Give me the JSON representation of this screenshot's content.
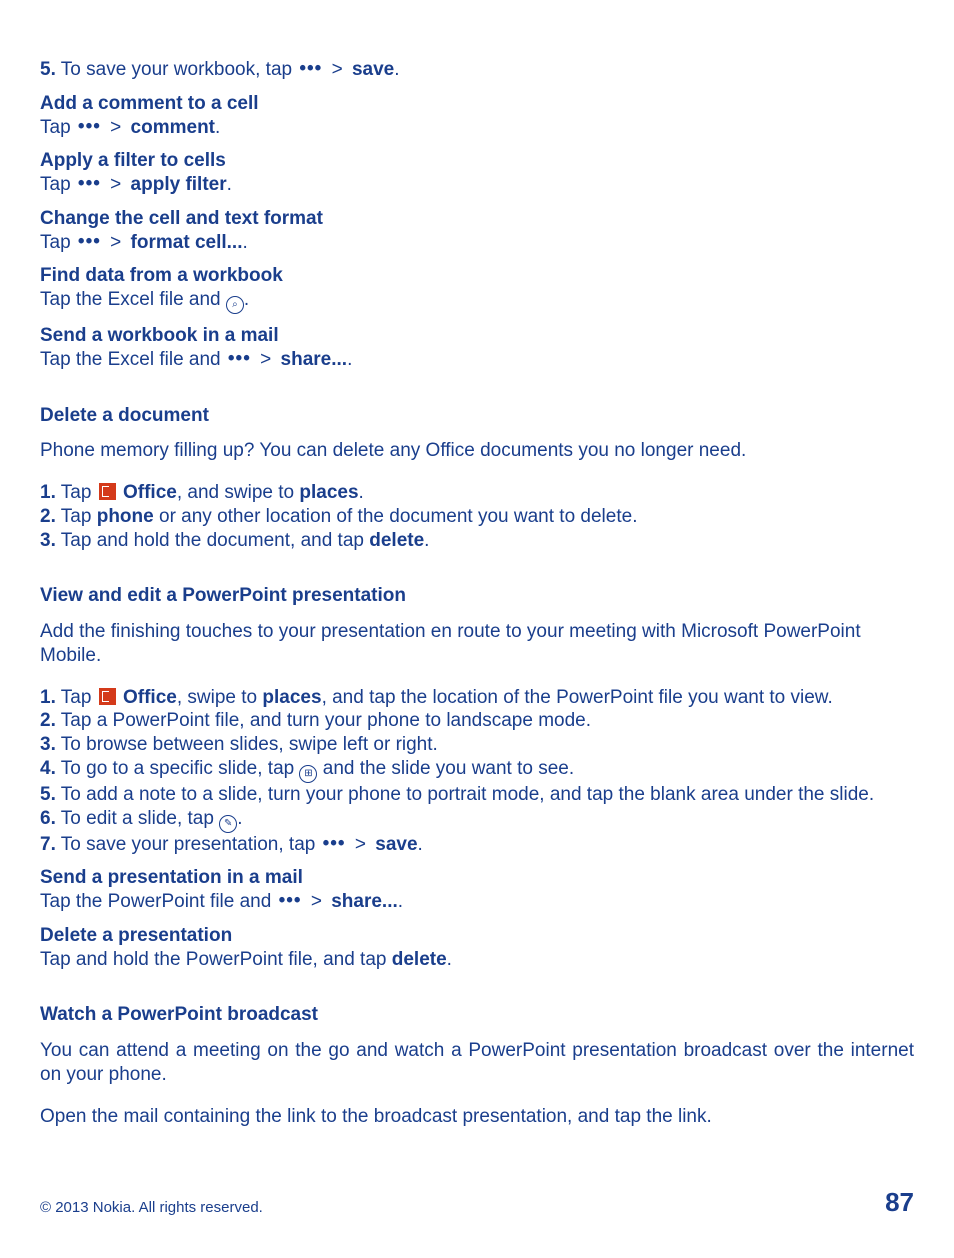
{
  "save_workbook": {
    "num": "5.",
    "pre": " To save your workbook, tap ",
    "after_dots": " > ",
    "bold": "save",
    "tail": "."
  },
  "add_comment": {
    "heading": "Add a comment to a cell",
    "pre": "Tap ",
    "after_dots": " > ",
    "bold": "comment",
    "tail": "."
  },
  "apply_filter": {
    "heading": "Apply a filter to cells",
    "pre": "Tap ",
    "after_dots": " > ",
    "bold": "apply filter",
    "tail": "."
  },
  "format_cell": {
    "heading": "Change the cell and text format",
    "pre": "Tap ",
    "after_dots": " > ",
    "bold": "format cell...",
    "tail": "."
  },
  "find_data": {
    "heading": "Find data from a workbook",
    "pre": "Tap the Excel file and ",
    "tail": "."
  },
  "send_workbook": {
    "heading": "Send a workbook in a mail",
    "pre": "Tap the Excel file and ",
    "after_dots": " > ",
    "bold": "share...",
    "tail": "."
  },
  "delete_doc": {
    "heading": "Delete a document",
    "intro": "Phone memory filling up? You can delete any Office documents you no longer need.",
    "s1": {
      "num": "1.",
      "pre": " Tap ",
      "bold1": "Office",
      "mid": ", and swipe to ",
      "bold2": "places",
      "tail": "."
    },
    "s2": {
      "num": "2.",
      "pre": " Tap ",
      "bold": "phone",
      "tail": " or any other location of the document you want to delete."
    },
    "s3": {
      "num": "3.",
      "pre": " Tap and hold the document, and tap ",
      "bold": "delete",
      "tail": "."
    }
  },
  "ppt": {
    "heading": "View and edit a PowerPoint presentation",
    "intro": "Add the finishing touches to your presentation en route to your meeting with Microsoft PowerPoint Mobile.",
    "s1": {
      "num": "1.",
      "pre": " Tap ",
      "bold1": "Office",
      "mid": ", swipe to ",
      "bold2": "places",
      "tail": ", and tap the location of the PowerPoint file you want to view."
    },
    "s2": {
      "num": "2.",
      "text": " Tap a PowerPoint file, and turn your phone to landscape mode."
    },
    "s3": {
      "num": "3.",
      "text": " To browse between slides, swipe left or right."
    },
    "s4": {
      "num": "4.",
      "pre": " To go to a specific slide, tap ",
      "tail": " and the slide you want to see."
    },
    "s5": {
      "num": "5.",
      "text": " To add a note to a slide, turn your phone to portrait mode, and tap the blank area under the slide."
    },
    "s6": {
      "num": "6.",
      "pre": " To edit a slide, tap ",
      "tail": "."
    },
    "s7": {
      "num": "7.",
      "pre": " To save your presentation, tap ",
      "after_dots": " > ",
      "bold": "save",
      "tail": "."
    }
  },
  "send_ppt": {
    "heading": "Send a presentation in a mail",
    "pre": "Tap the PowerPoint file and ",
    "after_dots": " > ",
    "bold": "share...",
    "tail": "."
  },
  "delete_ppt": {
    "heading": "Delete a presentation",
    "pre": "Tap and hold the PowerPoint file, and tap ",
    "bold": "delete",
    "tail": "."
  },
  "broadcast": {
    "heading": "Watch a PowerPoint broadcast",
    "p1": "You can attend a meeting on the go and watch a PowerPoint presentation broadcast over the internet on your phone.",
    "p2": "Open the mail containing the link to the broadcast presentation, and tap the link."
  },
  "footer": {
    "copyright": "© 2013 Nokia. All rights reserved.",
    "page": "87"
  },
  "glyphs": {
    "dots": "•••",
    "search": "⌕",
    "slides": "⊞",
    "edit": "✎"
  }
}
